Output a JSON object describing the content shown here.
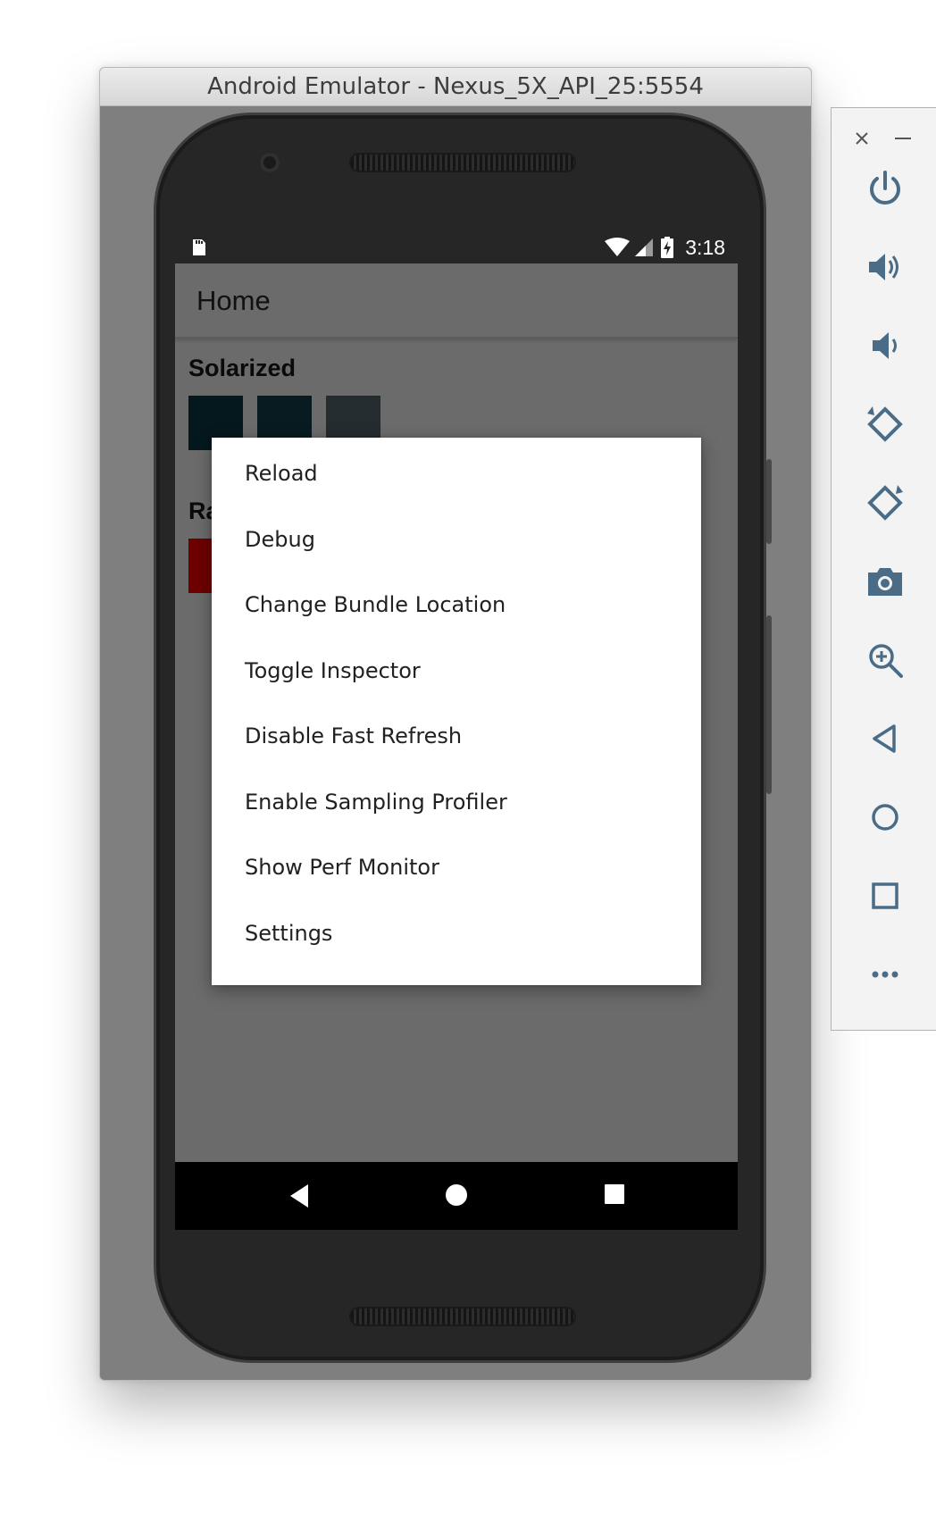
{
  "window": {
    "title": "Android Emulator - Nexus_5X_API_25:5554"
  },
  "status_bar": {
    "time": "3:18"
  },
  "app_bar": {
    "title": "Home"
  },
  "sections": [
    {
      "title": "Solarized",
      "swatch_colors": [
        "#04181d",
        "#071b20",
        "#252c2f"
      ]
    },
    {
      "title": "Ra",
      "swatch_colors": [
        "#6e0000"
      ]
    }
  ],
  "dev_menu": {
    "items": [
      "Reload",
      "Debug",
      "Change Bundle Location",
      "Toggle Inspector",
      "Disable Fast Refresh",
      "Enable Sampling Profiler",
      "Show Perf Monitor",
      "Settings"
    ]
  },
  "toolbar": {
    "window_controls": [
      "close-icon",
      "minimize-icon"
    ],
    "buttons": [
      "power-icon",
      "volume-up-icon",
      "volume-down-icon",
      "rotate-left-icon",
      "rotate-right-icon",
      "camera-icon",
      "zoom-icon",
      "back-icon",
      "home-icon",
      "overview-icon",
      "more-icon"
    ]
  },
  "nav_bar": {
    "buttons": [
      "back-icon",
      "home-icon",
      "overview-icon"
    ]
  }
}
